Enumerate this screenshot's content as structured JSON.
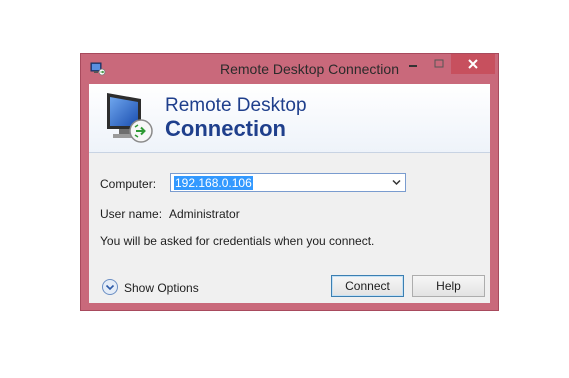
{
  "window": {
    "title": "Remote Desktop Connection",
    "controls": {
      "minimize": "minimize-icon",
      "maximize": "maximize-icon",
      "close": "close-icon"
    }
  },
  "banner": {
    "line1": "Remote Desktop",
    "line2": "Connection"
  },
  "form": {
    "computer_label": "Computer:",
    "computer_value": "192.168.0.106",
    "username_label": "User name:",
    "username_value": "Administrator",
    "info_text": "You will be asked for credentials when you connect."
  },
  "footer": {
    "show_options_label": "Show Options",
    "connect_label": "Connect",
    "help_label": "Help"
  },
  "colors": {
    "frame": "#c9697b",
    "close_button": "#c7505e",
    "banner_text": "#1f3f8c",
    "selection": "#3399ff"
  }
}
